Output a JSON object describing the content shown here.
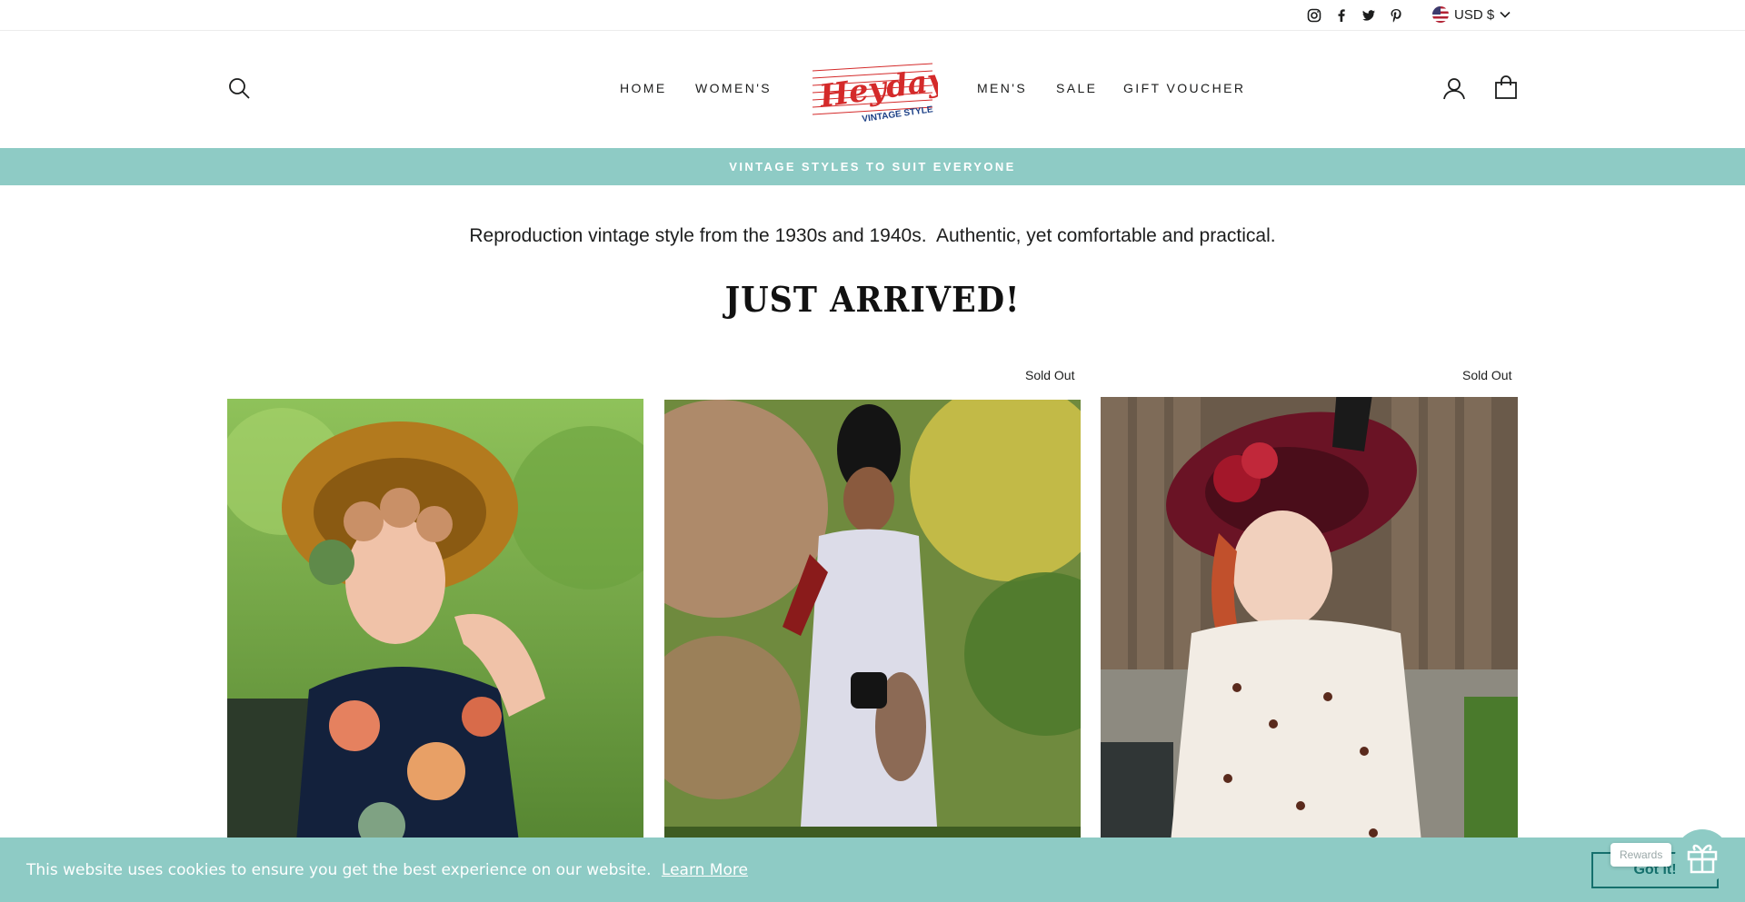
{
  "utility": {
    "social": [
      "instagram-icon",
      "facebook-icon",
      "twitter-icon",
      "pinterest-icon"
    ],
    "currency": "USD $"
  },
  "nav": {
    "home": "HOME",
    "womens": "WOMEN'S",
    "mens": "MEN'S",
    "sale": "SALE",
    "gift": "GIFT VOUCHER"
  },
  "logo": {
    "script": "Heyday!",
    "sub": "VINTAGE STYLE"
  },
  "announcement": "VINTAGE STYLES TO SUIT EVERYONE",
  "intro": "Reproduction vintage style from the 1930s and 1940s.  Authentic, yet comfortable and practical.",
  "section_title": "JUST ARRIVED!",
  "products": [
    {
      "badge": ""
    },
    {
      "badge": "Sold Out"
    },
    {
      "badge": "Sold Out"
    }
  ],
  "cookie": {
    "message": "This website uses cookies to ensure you get the best experience on our website.",
    "link": "Learn More",
    "button": "Got it!"
  },
  "rewards": {
    "label": "Rewards"
  },
  "colors": {
    "accent": "#8ecbc5",
    "button_text": "#15706d",
    "logo_red": "#d42a2a",
    "logo_blue": "#1b3f86"
  }
}
